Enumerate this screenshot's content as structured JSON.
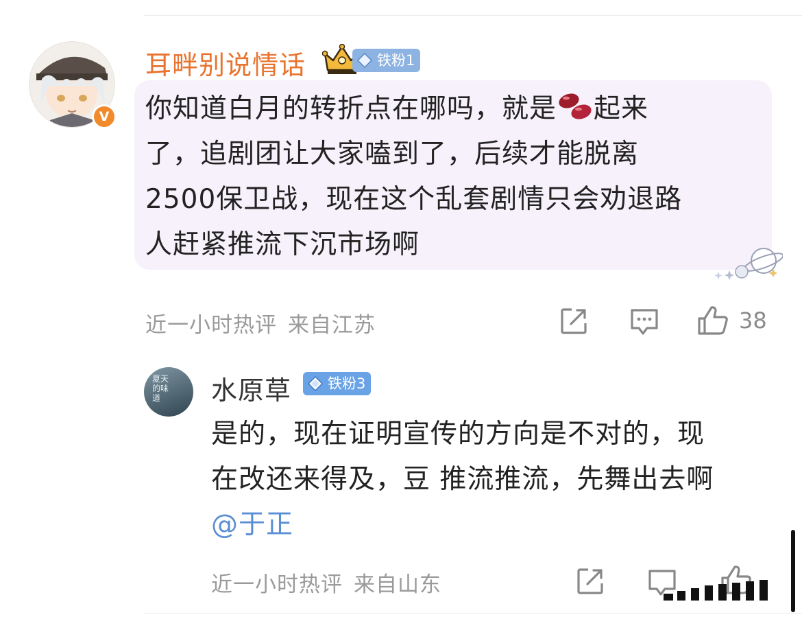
{
  "comment": {
    "username": "耳畔别说情话",
    "badge": "铁粉1",
    "text_before_emoji": "你知道白月的转折点在哪吗，就是",
    "text_after_emoji": "起来",
    "lines": [
      "了，追剧团让大家嗑到了，后续才能脱离",
      "2500保卫战，现在这个乱套剧情只会劝退路",
      "人赶紧推流下沉市场啊"
    ],
    "time": "近一小时热评",
    "location": "来自江苏",
    "like_count": "38",
    "verified_mark": "V"
  },
  "reply": {
    "username": "水原草",
    "badge": "铁粉3",
    "avatar_text": "夏天的味道",
    "lines": [
      "是的，现在证明宣传的方向是不对的，现",
      "在改还来得及，豆 推流推流，先舞出去啊"
    ],
    "mention": "@于正",
    "time": "近一小时热评",
    "location": "来自山东"
  },
  "colors": {
    "username_orange": "#e8742f",
    "username_gray": "#333333",
    "badge1_bg": "#8db3e3",
    "badge3_bg": "#6aa2e6",
    "bubble_bg": "#f7f1fb",
    "link_blue": "#5b8fd3",
    "meta_gray": "#9a9a9a"
  }
}
